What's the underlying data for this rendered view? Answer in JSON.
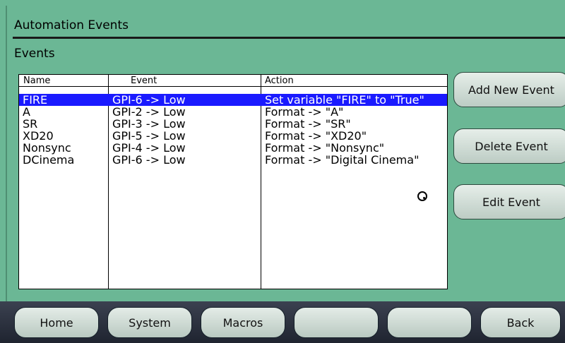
{
  "header": {
    "title": "Automation Events",
    "section": "Events"
  },
  "table": {
    "columns": [
      "Name",
      "Event",
      "Action"
    ],
    "rows": [
      {
        "name": "FIRE",
        "event": "GPI-6 -> Low",
        "action": "Set variable \"FIRE\" to \"True\"",
        "selected": true
      },
      {
        "name": "A",
        "event": "GPI-2 -> Low",
        "action": "Format -> \"A\""
      },
      {
        "name": "SR",
        "event": "GPI-3 -> Low",
        "action": "Format -> \"SR\""
      },
      {
        "name": "XD20",
        "event": "GPI-5 -> Low",
        "action": "Format -> \"XD20\""
      },
      {
        "name": "Nonsync",
        "event": "GPI-4 -> Low",
        "action": "Format -> \"Nonsync\""
      },
      {
        "name": "DCinema",
        "event": "GPI-6 -> Low",
        "action": "Format -> \"Digital Cinema\""
      }
    ]
  },
  "side_buttons": {
    "add": "Add New Event",
    "delete": "Delete Event",
    "edit": "Edit Event"
  },
  "bottom_nav": [
    "Home",
    "System",
    "Macros",
    "",
    "",
    "Back"
  ],
  "colors": {
    "background": "#6bb795",
    "selection": "#1a1aff",
    "nav_bar": "#2b303c"
  }
}
